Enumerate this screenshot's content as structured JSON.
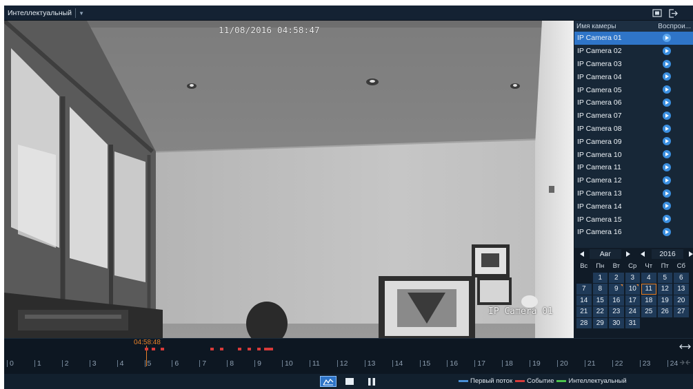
{
  "topbar": {
    "mode_label": "Интеллектуальный",
    "fullscreen_icon": "fullscreen-icon",
    "exit_icon": "exit-icon"
  },
  "video": {
    "osd_datetime": "11/08/2016 04:58:47",
    "osd_camera": "IP Camera 01"
  },
  "camera_list": {
    "header_name": "Имя камеры",
    "header_play": "Воспрои...",
    "cameras": [
      {
        "name": "IP Camera 01",
        "selected": true
      },
      {
        "name": "IP Camera 02"
      },
      {
        "name": "IP Camera 03"
      },
      {
        "name": "IP Camera 04"
      },
      {
        "name": "IP Camera 05"
      },
      {
        "name": "IP Camera 06"
      },
      {
        "name": "IP Camera 07"
      },
      {
        "name": "IP Camera 08"
      },
      {
        "name": "IP Camera 09"
      },
      {
        "name": "IP Camera 10"
      },
      {
        "name": "IP Camera 11"
      },
      {
        "name": "IP Camera 12"
      },
      {
        "name": "IP Camera 13"
      },
      {
        "name": "IP Camera 14"
      },
      {
        "name": "IP Camera 15"
      },
      {
        "name": "IP Camera 16"
      }
    ]
  },
  "calendar": {
    "month": "Авг",
    "year": "2016",
    "weekdays": [
      "Вс",
      "Пн",
      "Вт",
      "Ср",
      "Чт",
      "Пт",
      "Сб"
    ],
    "leading_blanks": 1,
    "days": [
      "1",
      "2",
      "3",
      "4",
      "5",
      "6",
      "7",
      "8",
      "9",
      "10",
      "11",
      "12",
      "13",
      "14",
      "15",
      "16",
      "17",
      "18",
      "19",
      "20",
      "21",
      "22",
      "23",
      "24",
      "25",
      "26",
      "27",
      "28",
      "29",
      "30",
      "31"
    ],
    "selected_day": "11",
    "marked_days": [
      "9",
      "10"
    ]
  },
  "timeline": {
    "current_time": "04:58:48",
    "hours": [
      "0",
      "1",
      "2",
      "3",
      "4",
      "5",
      "6",
      "7",
      "8",
      "9",
      "10",
      "11",
      "12",
      "13",
      "14",
      "15",
      "16",
      "17",
      "18",
      "19",
      "20",
      "21",
      "22",
      "23",
      "24"
    ],
    "events_hours": [
      5.02,
      5.26,
      5.58,
      7.4,
      7.75,
      8.4,
      8.75,
      9.1,
      9.35,
      9.48,
      9.55
    ]
  },
  "controls": {
    "graph_icon": "timeline-graph-icon",
    "stop_icon": "stop-icon",
    "pause_icon": "pause-icon"
  },
  "legend": [
    {
      "label": "Первый поток",
      "color": "#4a8fd6"
    },
    {
      "label": "Событие",
      "color": "#d83a3a"
    },
    {
      "label": "Интеллектуальный",
      "color": "#4cc24c"
    }
  ]
}
